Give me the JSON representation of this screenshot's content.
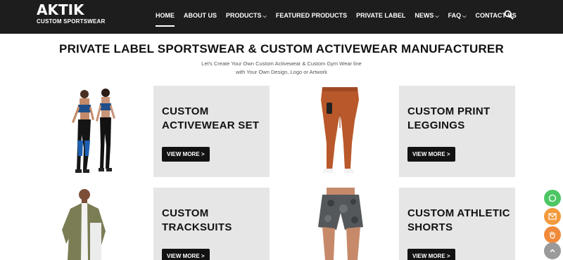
{
  "header": {
    "logo_text": "AKTIK",
    "logo_subtitle": "CUSTOM SPORTSWEAR",
    "nav": [
      {
        "label": "HOME",
        "active": true,
        "dropdown": false
      },
      {
        "label": "ABOUT US",
        "active": false,
        "dropdown": false
      },
      {
        "label": "PRODUCTS",
        "active": false,
        "dropdown": true
      },
      {
        "label": "FEATURED PRODUCTS",
        "active": false,
        "dropdown": false
      },
      {
        "label": "PRIVATE LABEL",
        "active": false,
        "dropdown": false
      },
      {
        "label": "NEWS",
        "active": false,
        "dropdown": true
      },
      {
        "label": "FAQ",
        "active": false,
        "dropdown": true
      },
      {
        "label": "CONTACT US",
        "active": false,
        "dropdown": false
      }
    ],
    "search_icon": "search-icon"
  },
  "hero": {
    "title": "PRIVATE LABEL SPORTSWEAR & CUSTOM ACTIVEWEAR MANUFACTURER",
    "subtitle_line1": "Let's Create Your Own Custom Activewear & Custom Gym Wear line",
    "subtitle_line2": "with Your Own Design, Logo or Artwork"
  },
  "products": [
    {
      "title_line1": "CUSTOM",
      "title_line2": "ACTIVEWEAR SET",
      "button": "VIEW MORE >",
      "image": "activewear-set-models"
    },
    {
      "title_line1": "CUSTOM PRINT",
      "title_line2": "LEGGINGS",
      "button": "VIEW MORE >",
      "image": "rust-leggings"
    },
    {
      "title_line1": "CUSTOM",
      "title_line2": "TRACKSUITS",
      "button": "VIEW MORE >",
      "image": "tracksuit-model"
    },
    {
      "title_line1": "CUSTOM ATHLETIC",
      "title_line2": "SHORTS",
      "button": "VIEW MORE >",
      "image": "camo-shorts-model"
    }
  ],
  "floating": [
    {
      "icon": "whatsapp-icon",
      "color": "#4cc764"
    },
    {
      "icon": "email-icon",
      "color": "#f39a3c"
    },
    {
      "icon": "hand-icon",
      "color": "#f08a3a"
    },
    {
      "icon": "arrow-up-icon",
      "color": "#9a9a9a"
    }
  ],
  "colors": {
    "header_bg": "#1d1d1d",
    "card_bg": "#e6e6e6",
    "button_bg": "#121212",
    "legging_orange": "#b9582a"
  }
}
